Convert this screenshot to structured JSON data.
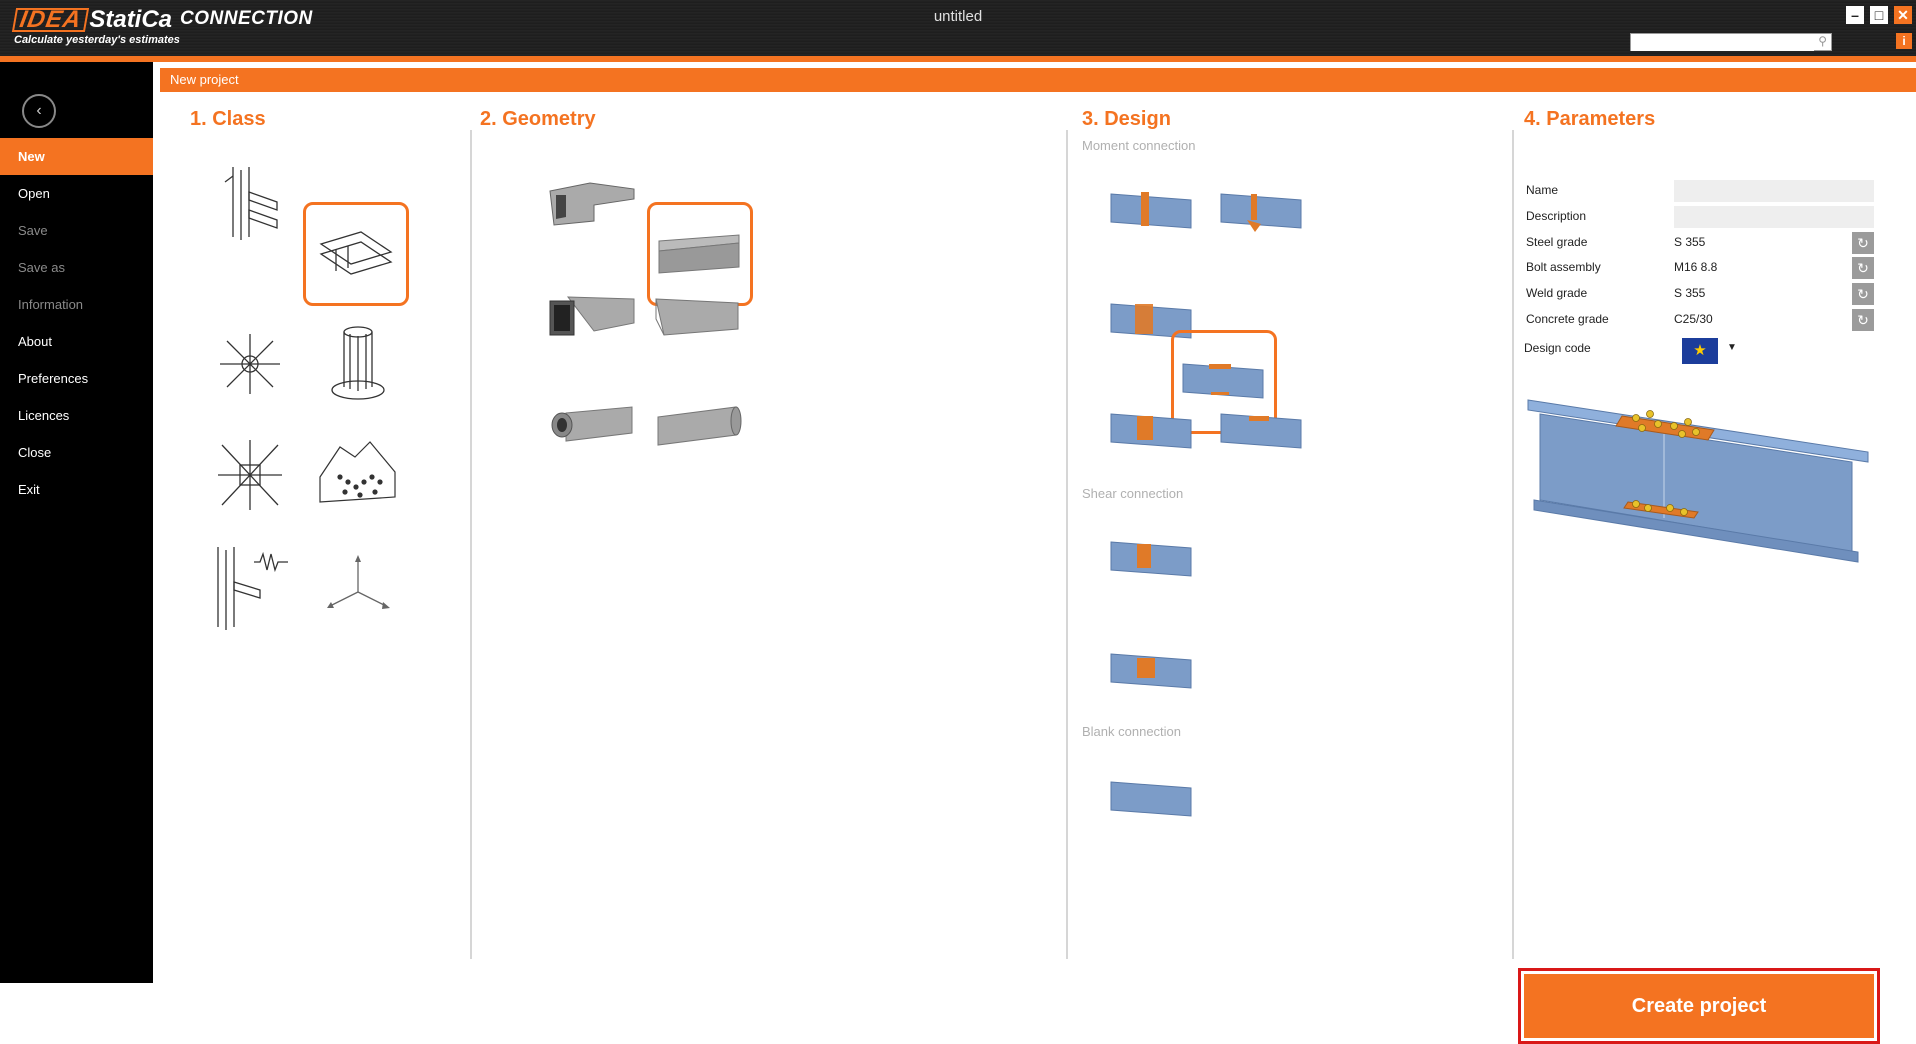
{
  "app": {
    "logo_brand": "IDEA",
    "logo_brand2": "StatiCa",
    "product": "CONNECTION",
    "tagline": "Calculate yesterday's estimates",
    "document_title": "untitled",
    "window_buttons": {
      "minimize": "–",
      "maximize": "□",
      "close": "✕"
    },
    "search_placeholder": "",
    "info_label": "i"
  },
  "sidebar": {
    "back_label": "‹",
    "items": [
      {
        "label": "New",
        "state": "active"
      },
      {
        "label": "Open",
        "state": "normal"
      },
      {
        "label": "Save",
        "state": "disabled"
      },
      {
        "label": "Save as",
        "state": "disabled"
      },
      {
        "label": "Information",
        "state": "disabled"
      },
      {
        "label": "About",
        "state": "normal"
      },
      {
        "label": "Preferences",
        "state": "normal"
      },
      {
        "label": "Licences",
        "state": "normal"
      },
      {
        "label": "Close",
        "state": "normal"
      },
      {
        "label": "Exit",
        "state": "normal"
      }
    ]
  },
  "header": {
    "title": "New project"
  },
  "sections": {
    "class": {
      "title": "1.  Class",
      "items": [
        "beam-column-joint",
        "beam-splice",
        "truss-node",
        "column-base",
        "multi-member-node",
        "gusset-plate",
        "stiffness-analysis",
        "general"
      ],
      "selected": 1
    },
    "geometry": {
      "title": "2. Geometry",
      "items": [
        "i-beam-joint",
        "i-beam-straight",
        "rhs-joint",
        "rhs-straight",
        "chs-joint",
        "chs-straight"
      ],
      "selected": 1
    },
    "design": {
      "title": "3. Design",
      "moment_label": "Moment connection",
      "shear_label": "Shear connection",
      "blank_label": "Blank connection",
      "selected": 3
    },
    "parameters": {
      "title": "4. Parameters",
      "name_label": "Name",
      "name_value": "",
      "description_label": "Description",
      "description_value": "",
      "steel_label": "Steel grade",
      "steel_value": "S 355",
      "bolt_label": "Bolt assembly",
      "bolt_value": "M16 8.8",
      "weld_label": "Weld grade",
      "weld_value": "S 355",
      "concrete_label": "Concrete grade",
      "concrete_value": "C25/30",
      "design_code_label": "Design code",
      "design_code_flag": "★",
      "design_code_arrow": "▼",
      "reset_glyph": "↻",
      "create_label": "Create project"
    }
  },
  "colors": {
    "accent": "#f47321",
    "steel_blue": "#7c9cc8",
    "plate": "#e07a28"
  }
}
